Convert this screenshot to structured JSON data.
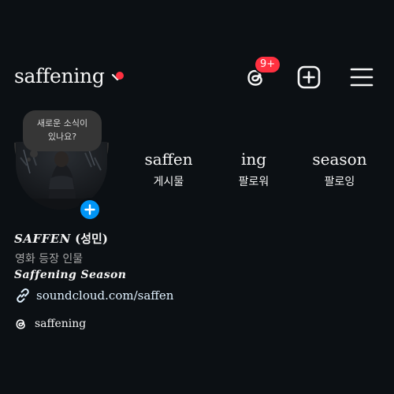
{
  "header": {
    "username": "saffening",
    "threads_badge": "9+"
  },
  "note": {
    "line1": "새로운 소식이",
    "line2": "있나요?"
  },
  "stats": [
    {
      "value": "saffen",
      "label": "게시물"
    },
    {
      "value": "ing",
      "label": "팔로워"
    },
    {
      "value": "season",
      "label": "팔로잉"
    }
  ],
  "profile": {
    "display_name": "SAFFEN",
    "display_name_suffix": "(성민)",
    "category": "영화 등장 인물",
    "bio": "Saffening Season",
    "link": "soundcloud.com/saffen",
    "threads_handle": "saffening"
  },
  "colors": {
    "background": "#0c1014",
    "accent_blue": "#0095f6",
    "notification_red": "#ff3040"
  },
  "icons": [
    "chevron-down-icon",
    "threads-icon",
    "add-post-icon",
    "menu-icon",
    "plus-icon",
    "link-icon"
  ]
}
